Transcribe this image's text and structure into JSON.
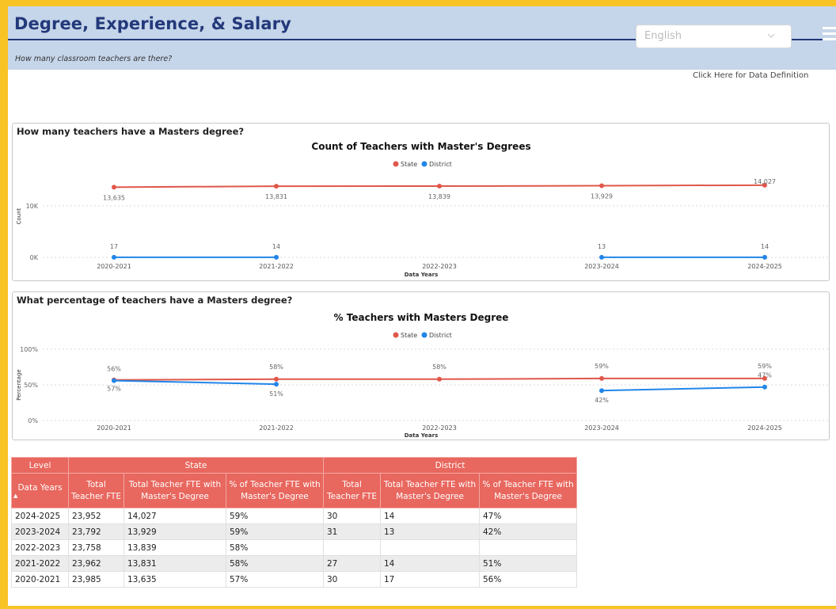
{
  "header": {
    "title": "Degree, Experience, & Salary",
    "subtitle": "How many classroom teachers are there?",
    "language": "English",
    "data_definition_link": "Click Here for Data Definition"
  },
  "colors": {
    "state": "#e0574a",
    "district": "#2186e9",
    "header_bg": "#c5d5ea",
    "title": "#23397a",
    "table_header": "#e8675e"
  },
  "icons": {
    "language_dropdown": "chevron-down-icon",
    "menu": "hamburger-menu-icon"
  },
  "chart1": {
    "question": "How many teachers have a Masters degree?"
  },
  "chart2": {
    "question": "What percentage of teachers have a Masters degree?"
  },
  "chart_data": [
    {
      "type": "line",
      "title": "Count of Teachers with Master's Degrees",
      "xlabel": "Data Years",
      "ylabel": "Count",
      "categories": [
        "2020-2021",
        "2021-2022",
        "2022-2023",
        "2023-2024",
        "2024-2025"
      ],
      "y_ticks": [
        "0K",
        "10K"
      ],
      "ylim": [
        0,
        16000
      ],
      "legend": "top-center",
      "series": [
        {
          "name": "State",
          "values": [
            13635,
            13831,
            13839,
            13929,
            14027
          ],
          "labels": [
            "13,635",
            "13,831",
            "13,839",
            "13,929",
            "14,027"
          ]
        },
        {
          "name": "District",
          "values": [
            17,
            14,
            null,
            13,
            14
          ],
          "labels": [
            "17",
            "14",
            "",
            "13",
            "14"
          ]
        }
      ]
    },
    {
      "type": "line",
      "title": "% Teachers with Masters Degree",
      "xlabel": "Data Years",
      "ylabel": "Percentage",
      "categories": [
        "2020-2021",
        "2021-2022",
        "2022-2023",
        "2023-2024",
        "2024-2025"
      ],
      "y_ticks": [
        "0%",
        "50%",
        "100%"
      ],
      "ylim": [
        0,
        100
      ],
      "legend": "top-center",
      "series": [
        {
          "name": "State",
          "values": [
            57,
            58,
            58,
            59,
            59
          ],
          "labels": [
            "57%",
            "58%",
            "58%",
            "59%",
            "59%"
          ]
        },
        {
          "name": "District",
          "values": [
            56,
            51,
            null,
            42,
            47
          ],
          "labels": [
            "56%",
            "51%",
            "",
            "42%",
            "47%"
          ]
        }
      ]
    }
  ],
  "table": {
    "level_label": "Level",
    "state_group": "State",
    "district_group": "District",
    "columns": [
      "Data Years",
      "Total Teacher FTE",
      "Total Teacher FTE with Master's Degree",
      "% of Teacher FTE with Master's Degree",
      "Total Teacher FTE",
      "Total Teacher FTE with Master's Degree",
      "% of Teacher FTE with Master's Degree"
    ],
    "rows": [
      [
        "2024-2025",
        "23,952",
        "14,027",
        "59%",
        "30",
        "14",
        "47%"
      ],
      [
        "2023-2024",
        "23,792",
        "13,929",
        "59%",
        "31",
        "13",
        "42%"
      ],
      [
        "2022-2023",
        "23,758",
        "13,839",
        "58%",
        "",
        "",
        ""
      ],
      [
        "2021-2022",
        "23,962",
        "13,831",
        "58%",
        "27",
        "14",
        "51%"
      ],
      [
        "2020-2021",
        "23,985",
        "13,635",
        "57%",
        "30",
        "17",
        "56%"
      ]
    ]
  }
}
